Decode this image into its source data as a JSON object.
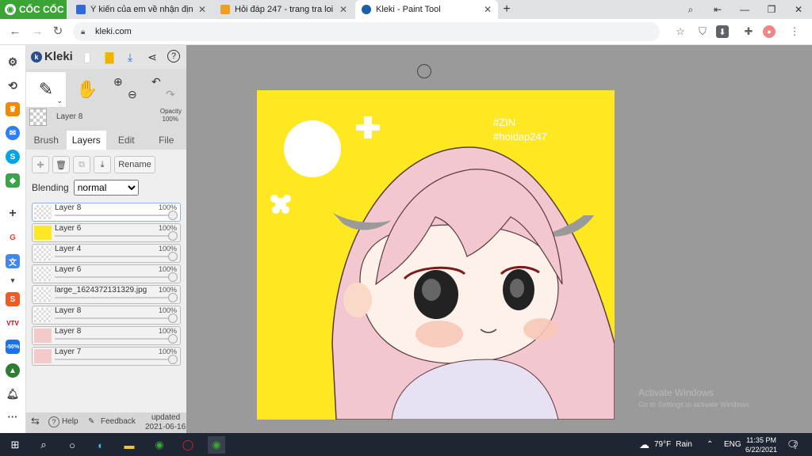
{
  "browser": {
    "brand": "CỐC CỐC",
    "tabs": [
      {
        "title": "Ý kiến của em về nhận định c"
      },
      {
        "title": "Hỏi đáp 247 - trang tra loi"
      },
      {
        "title": "Kleki - Paint Tool"
      }
    ],
    "new_tab": "+",
    "url": "kleki.com"
  },
  "kleki": {
    "logo": "Kleki",
    "current_layer": "Layer 8",
    "opacity_label": "Opacity",
    "opacity_value": "100%",
    "tabs": [
      "Brush",
      "Layers",
      "Edit",
      "File"
    ],
    "active_tab": "Layers",
    "rename_label": "Rename",
    "blending_label": "Blending",
    "blending_value": "normal",
    "layers": [
      {
        "name": "Layer 8",
        "opacity": "100%"
      },
      {
        "name": "Layer 6",
        "opacity": "100%"
      },
      {
        "name": "Layer 4",
        "opacity": "100%"
      },
      {
        "name": "Layer 6",
        "opacity": "100%"
      },
      {
        "name": "large_1624372131329.jpg",
        "opacity": "100%"
      },
      {
        "name": "Layer 8",
        "opacity": "100%"
      },
      {
        "name": "Layer 8",
        "opacity": "100%"
      },
      {
        "name": "Layer 7",
        "opacity": "100%"
      }
    ],
    "footer": {
      "help": "Help",
      "feedback": "Feedback",
      "updated_label": "updated",
      "updated_date": "2021-06-16"
    }
  },
  "canvas": {
    "watermark_line1": "#ZIN",
    "watermark_line2": "#hoidap247",
    "background": "#fde821"
  },
  "windows": {
    "activate_title": "Activate Windows",
    "activate_sub": "Go to Settings to activate Windows.",
    "weather_temp": "79°F",
    "weather_cond": "Rain",
    "lang": "ENG",
    "time": "11:35 PM",
    "date": "6/22/2021",
    "notif_count": "2"
  }
}
